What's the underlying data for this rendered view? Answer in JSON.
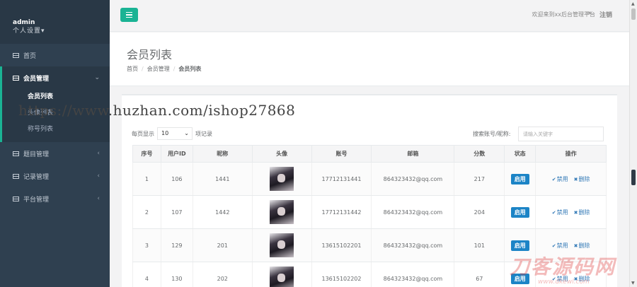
{
  "sidebar": {
    "username": "admin",
    "settings": "个人设置",
    "items": [
      {
        "label": "首页"
      },
      {
        "label": "会员管理",
        "sub": [
          "会员列表",
          "头像列表",
          "称号列表"
        ]
      },
      {
        "label": "题目管理"
      },
      {
        "label": "记录管理"
      },
      {
        "label": "平台管理"
      }
    ]
  },
  "topbar": {
    "welcome": "欢迎来到xx后台管理平台",
    "logout": "注销"
  },
  "heading": {
    "title": "会员列表",
    "breadcrumb": [
      "首页",
      "会员管理",
      "会员列表"
    ]
  },
  "controls": {
    "per_page_prefix": "每页显示",
    "per_page_value": "10",
    "per_page_suffix": "项记录",
    "search_label": "搜索账号/昵称:",
    "search_placeholder": "请输入关键字"
  },
  "table": {
    "headers": [
      "序号",
      "用户ID",
      "昵称",
      "头像",
      "账号",
      "邮箱",
      "分数",
      "状态",
      "操作"
    ],
    "status_label": "启用",
    "op_disable": "禁用",
    "op_delete": "删除",
    "rows": [
      {
        "no": "1",
        "uid": "106",
        "nick": "1441",
        "account": "17712131441",
        "email": "864323432@qq.com",
        "score": "217"
      },
      {
        "no": "2",
        "uid": "107",
        "nick": "1442",
        "account": "17712131442",
        "email": "864323432@qq.com",
        "score": "204"
      },
      {
        "no": "3",
        "uid": "129",
        "nick": "201",
        "account": "13615102201",
        "email": "864323432@qq.com",
        "score": "101"
      },
      {
        "no": "4",
        "uid": "130",
        "nick": "202",
        "account": "13615102202",
        "email": "864323432@qq.com",
        "score": "67"
      }
    ]
  },
  "watermarks": {
    "url": "https://www.huzhan.com/ishop27868",
    "brand": "刀客源码网",
    "brand_url": "www.dkewl.com"
  },
  "colors": {
    "sidebar_bg": "#2f4050",
    "accent": "#1ab394",
    "status_btn": "#1c84c6"
  }
}
